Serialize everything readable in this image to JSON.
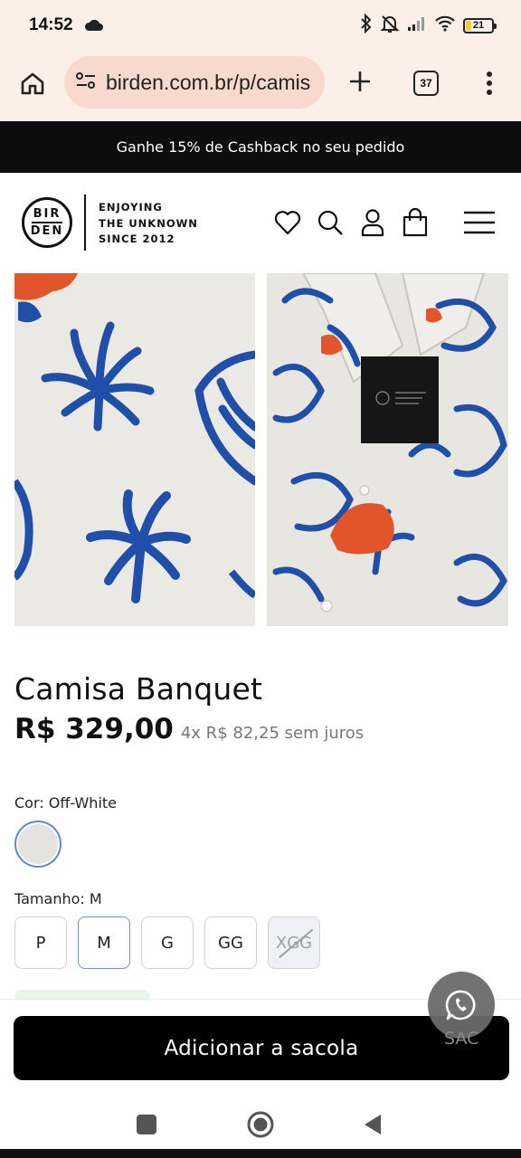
{
  "status_bar": {
    "time": "14:52",
    "battery_level": "21",
    "battery_fraction": 0.21,
    "icons": [
      "cloud-icon",
      "bluetooth-icon",
      "bell-off-icon",
      "signal-icon",
      "wifi-icon",
      "battery-icon"
    ]
  },
  "browser": {
    "url": "birden.com.br/p/camis",
    "tab_count": "37",
    "icons": [
      "home-icon",
      "site-settings-icon",
      "plus-icon",
      "tabs-icon",
      "more-vert-icon"
    ]
  },
  "promo": {
    "text": "Ganhe 15% de Cashback no seu pedido"
  },
  "header": {
    "logo_top": "BIR",
    "logo_bottom": "DEN",
    "tagline_1": "ENJOYING",
    "tagline_2": "THE UNKNOWN",
    "tagline_3": "SINCE 2012",
    "icons": [
      "heart-icon",
      "search-icon",
      "user-icon",
      "bag-icon",
      "hamburger-menu-icon"
    ]
  },
  "product": {
    "title": "Camisa Banquet",
    "price": "R$ 329,00",
    "installments": "4x R$ 82,25 sem juros",
    "color_label": "Cor: Off-White",
    "size_label": "Tamanho: M",
    "sizes": [
      {
        "label": "P",
        "state": "available"
      },
      {
        "label": "M",
        "state": "selected"
      },
      {
        "label": "G",
        "state": "available"
      },
      {
        "label": "GG",
        "state": "available"
      },
      {
        "label": "XGG",
        "state": "unavailable"
      }
    ]
  },
  "colors": {
    "promo_bg": "#0d0d0d",
    "browser_bg": "#fcefe8",
    "url_pill": "#f7d9cd",
    "print_blue": "#1f4fa8",
    "print_orange": "#e2552b",
    "selected_border": "#6d92d6"
  },
  "cta": {
    "add_to_bag": "Adicionar a sacola"
  },
  "chat": {
    "label": "SAC",
    "icon": "whatsapp-icon"
  },
  "nav": {
    "icons": [
      "recents-icon",
      "home-circle-icon",
      "back-icon"
    ]
  }
}
